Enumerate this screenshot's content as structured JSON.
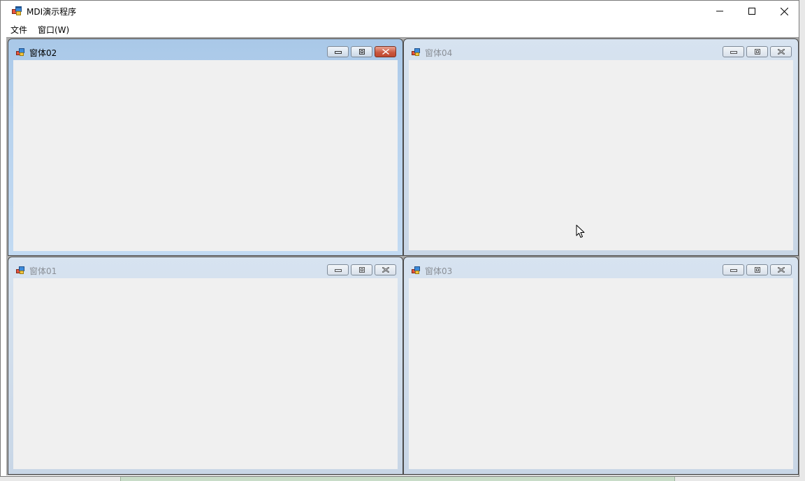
{
  "window": {
    "title": "MDI演示程序",
    "controls": {
      "minimize": "minimize",
      "maximize": "maximize",
      "close": "close"
    }
  },
  "menu": {
    "items": [
      {
        "label": "文件"
      },
      {
        "label": "窗口(W)"
      }
    ]
  },
  "children": [
    {
      "title": "窗体02",
      "state": "active"
    },
    {
      "title": "窗体04",
      "state": "inactive"
    },
    {
      "title": "窗体01",
      "state": "inactive"
    },
    {
      "title": "窗体03",
      "state": "inactive"
    }
  ],
  "colors": {
    "active_caption": "#b9d3ee",
    "inactive_caption": "#d0dcea",
    "mdi_background": "#ababab",
    "client_background": "#f0f0f0",
    "active_close": "#c9553c"
  },
  "icons": {
    "app": "mdi-app-icon",
    "child": "form-icon",
    "cursor": "mouse-pointer"
  }
}
